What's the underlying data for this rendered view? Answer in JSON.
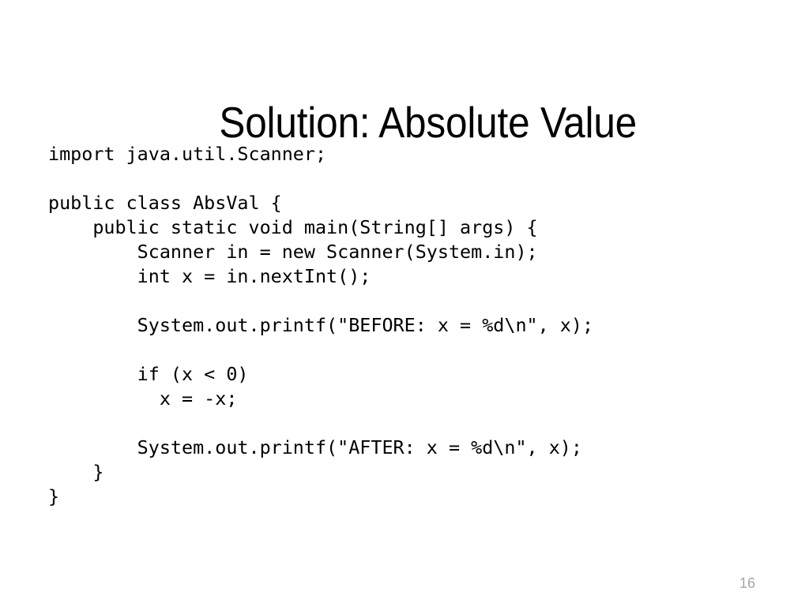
{
  "slide": {
    "title": "Solution: Absolute Value",
    "page_number": "16",
    "background_color": "#ffffff",
    "title_color": "#000000",
    "code_color": "#000000",
    "page_number_color": "#a6a6a6"
  },
  "code": {
    "language": "java",
    "lines": [
      "import java.util.Scanner;",
      "",
      "public class AbsVal {",
      "    public static void main(String[] args) {",
      "        Scanner in = new Scanner(System.in);",
      "        int x = in.nextInt();",
      "",
      "        System.out.printf(\"BEFORE: x = %d\\n\", x);",
      "",
      "        if (x < 0)",
      "          x = -x;",
      "",
      "        System.out.printf(\"AFTER: x = %d\\n\", x);",
      "    }",
      "}"
    ]
  }
}
